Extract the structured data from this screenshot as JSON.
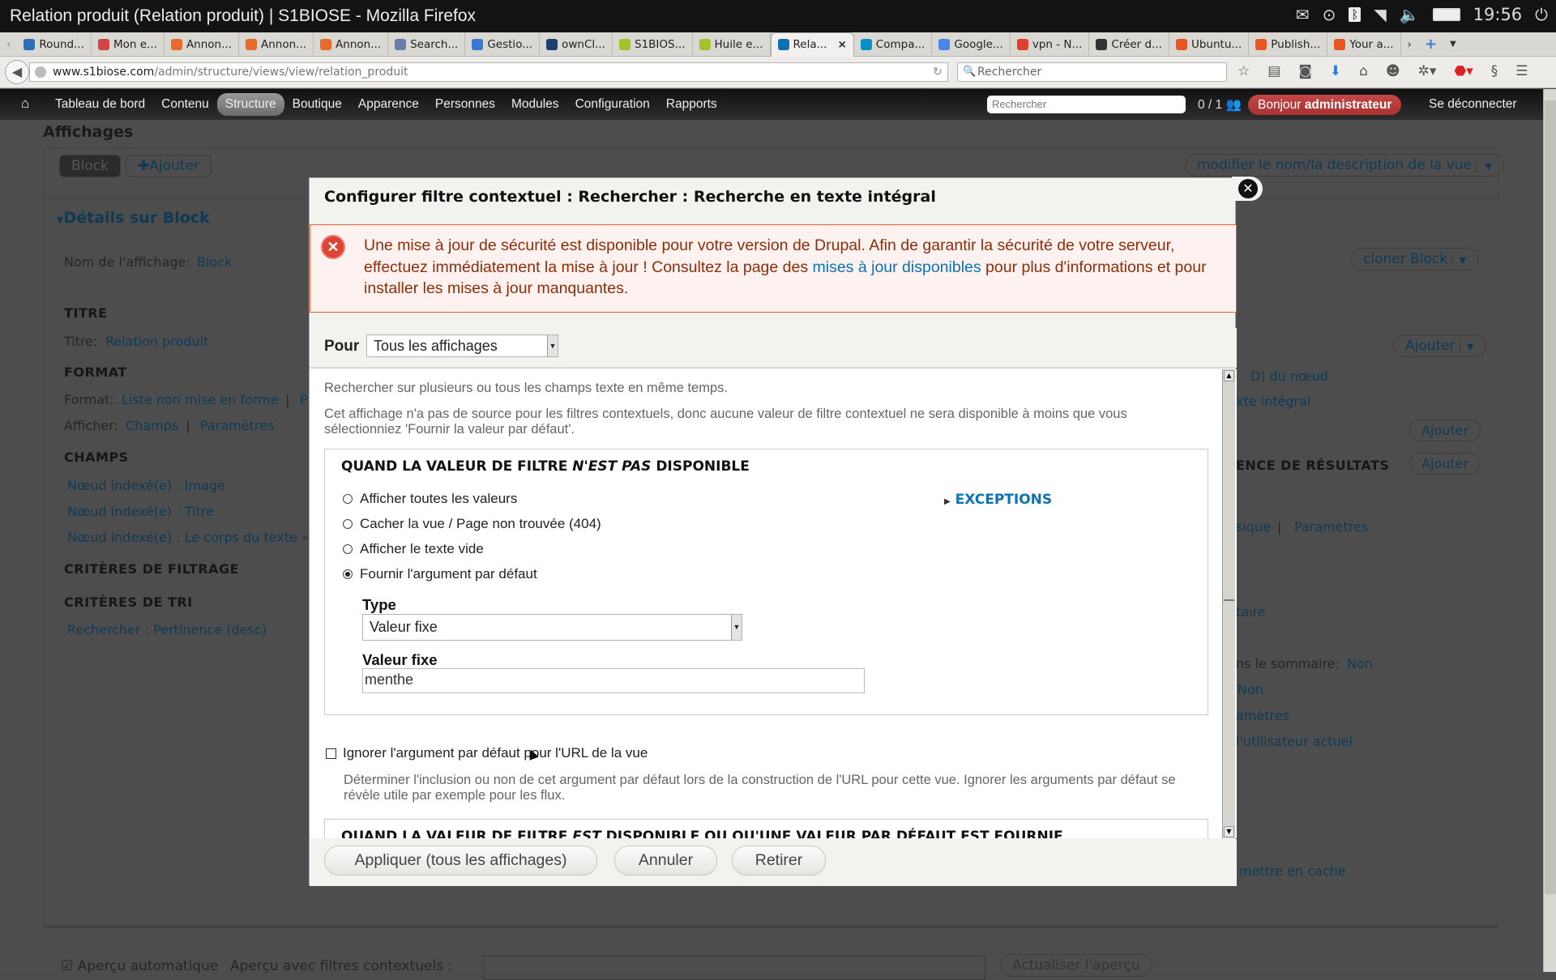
{
  "window": {
    "title": "Relation produit (Relation produit) | S1BIOSE - Mozilla Firefox",
    "clock": "19:56",
    "tray_icons": [
      "mail-icon",
      "location-icon",
      "bluetooth-icon",
      "wifi-icon",
      "volume-icon",
      "battery-icon",
      "power-icon"
    ]
  },
  "tabs": [
    {
      "label": "Round...",
      "color": "#2a6fb8"
    },
    {
      "label": "Mon e...",
      "color": "#d04545"
    },
    {
      "label": "Annon...",
      "color": "#e86b2b"
    },
    {
      "label": "Annon...",
      "color": "#e86b2b"
    },
    {
      "label": "Annon...",
      "color": "#e86b2b"
    },
    {
      "label": "Search...",
      "color": "#6a7fa8"
    },
    {
      "label": "Gestio...",
      "color": "#3a78d4"
    },
    {
      "label": "ownCl...",
      "color": "#1d3f6e"
    },
    {
      "label": "S1BIOS...",
      "color": "#a3c22b"
    },
    {
      "label": "Huile e...",
      "color": "#a3c22b"
    },
    {
      "label": "Rela...",
      "color": "#0e6fb3",
      "active": true
    },
    {
      "label": "Compa...",
      "color": "#0e8fc3"
    },
    {
      "label": "Google...",
      "color": "#4a86e8"
    },
    {
      "label": "vpn - N...",
      "color": "#e1402e"
    },
    {
      "label": "Créer d...",
      "color": "#333333"
    },
    {
      "label": "Ubuntu...",
      "color": "#e95420"
    },
    {
      "label": "Publish...",
      "color": "#e95420"
    },
    {
      "label": "Your a...",
      "color": "#e95420"
    }
  ],
  "tab_close": "×",
  "navbar": {
    "url_host": "www.s1biose.com",
    "url_path": "/admin/structure/views/view/relation_produit",
    "search_placeholder": "Rechercher"
  },
  "admin_menu": {
    "items": [
      "Tableau de bord",
      "Contenu",
      "Structure",
      "Boutique",
      "Apparence",
      "Personnes",
      "Modules",
      "Configuration",
      "Rapports"
    ],
    "active": "Structure",
    "search_placeholder": "Rechercher",
    "user_count": "0 / 1",
    "greeting": "Bonjour",
    "username": "administrateur",
    "logout": "Se déconnecter"
  },
  "background": {
    "section_title": "Affichages",
    "display_tab": "Block",
    "add_display": "Ajouter",
    "edit_view_name": "modifier le nom/la description de la vue",
    "details_title": "Détails sur Block",
    "display_name_label": "Nom de l'affichage:",
    "display_name_value": "Block",
    "clone_button": "cloner Block",
    "titre_head": "TITRE",
    "titre_label": "Titre:",
    "titre_value": "Relation produit",
    "format_head": "FORMAT",
    "format_label": "Format:",
    "format_value": "Liste non mise en forme",
    "format_sep": "|",
    "format_more": "P",
    "afficher_label": "Afficher:",
    "afficher_value": "Champs",
    "afficher_settings": "Paramètres",
    "champs_head": "CHAMPS",
    "champs": [
      "Nœud indexé(e) : Image",
      "Nœud indexé(e) : Titre",
      "Nœud indexé(e) : Le corps du texte »"
    ],
    "filtrage_head": "CRITÈRES DE FILTRAGE",
    "tri_head": "CRITÈRES DE TRI",
    "tri_item": "Rechercher : Pertinence (desc)",
    "right_add": "Ajouter",
    "right_items": [
      "D) du nœud",
      "xte intégral"
    ],
    "right_head": "ENCE DE RÉSULTATS",
    "right_physique": "sique",
    "right_settings": "Paramètres",
    "right_taire": "taire",
    "right_sommaire_label": "ns le sommaire:",
    "right_sommaire_value": "Non",
    "right_non": "Non",
    "right_ametres": "amètres",
    "right_user": "l'utilisateur actuel",
    "right_cache": "mettre en cache",
    "preview_auto": "Aperçu automatique",
    "preview_filters": "Aperçu avec filtres contextuels :",
    "preview_button": "Actualiser l'aperçu"
  },
  "dialog": {
    "title": "Configurer filtre contextuel : Rechercher : Recherche en texte intégral",
    "alert_text_1": "Une mise à jour de sécurité est disponible pour votre version de Drupal. Afin de garantir la sécurité de votre serveur, effectuez immédiatement la mise à jour ! Consultez la page des ",
    "alert_link": "mises à jour disponibles",
    "alert_text_2": " pour plus d'informations et pour installer les mises à jour manquantes.",
    "pour_label": "Pour",
    "pour_value": "Tous les affichages",
    "desc_1": "Rechercher sur plusieurs ou tous les champs texte en même temps.",
    "desc_2": "Cet affichage n'a pas de source pour les filtres contextuels, donc aucune valeur de filtre contextuel ne sera disponible à moins que vous sélectionniez 'Fournir la valeur par défaut'.",
    "fs1_title_a": "QUAND LA VALEUR DE FILTRE ",
    "fs1_title_em": "N'EST PAS",
    "fs1_title_b": " DISPONIBLE",
    "radios": [
      {
        "label": "Afficher toutes les valeurs",
        "checked": false
      },
      {
        "label": "Cacher la vue / Page non trouvée (404)",
        "checked": false
      },
      {
        "label": "Afficher le texte vide",
        "checked": false
      },
      {
        "label": "Fournir l'argument par défaut",
        "checked": true
      }
    ],
    "exceptions": "EXCEPTIONS",
    "type_label": "Type",
    "type_value": "Valeur fixe",
    "fixed_label": "Valeur fixe",
    "fixed_value": "menthe",
    "ignore_label": "Ignorer l'argument par défaut pour l'URL de la vue",
    "ignore_checked": false,
    "ignore_desc": "Déterminer l'inclusion ou non de cet argument par défaut lors de la construction de l'URL pour cette vue. Ignorer les arguments par défaut se révèle utile par exemple pour les flux.",
    "fs2_title_a": "QUAND LA VALEUR DE FILTRE ",
    "fs2_title_em": "EST",
    "fs2_title_b": " DISPONIBLE OU QU'UNE VALEUR PAR DÉFAUT EST FOURNIE",
    "apply": "Appliquer (tous les affichages)",
    "cancel": "Annuler",
    "remove": "Retirer"
  }
}
